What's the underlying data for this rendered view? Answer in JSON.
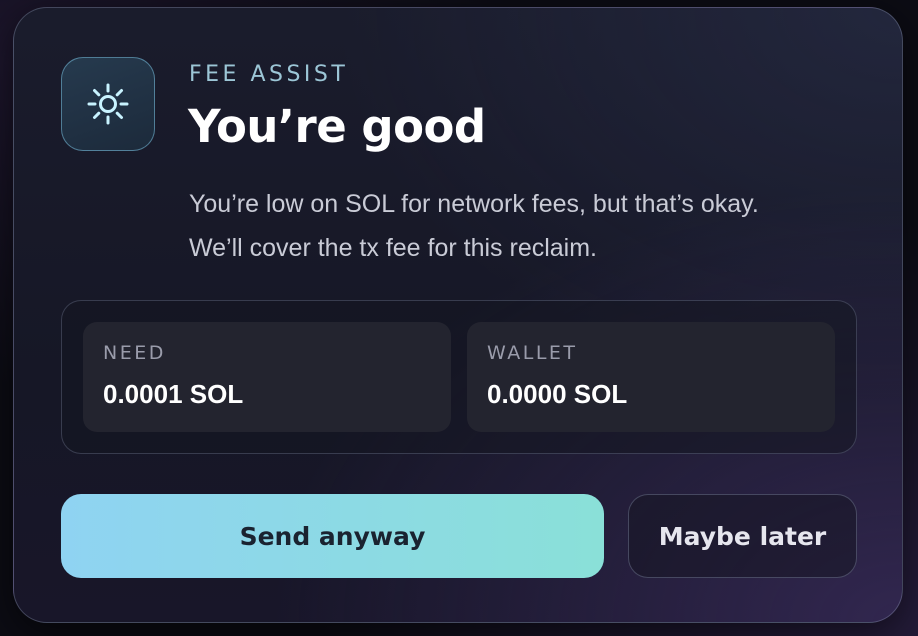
{
  "card": {
    "icon": "sun-icon",
    "eyebrow": "FEE ASSIST",
    "title": "You’re good",
    "body_line1": "You’re low on SOL for network fees, but that’s okay.",
    "body_line2": "We’ll cover the tx fee for this reclaim."
  },
  "stats": {
    "need": {
      "label": "NEED",
      "value": "0.0001 SOL"
    },
    "wallet": {
      "label": "WALLET",
      "value": "0.0000 SOL"
    }
  },
  "actions": {
    "primary_label": "Send anyway",
    "secondary_label": "Maybe later"
  },
  "colors": {
    "accent_start": "#8fd3f2",
    "accent_end": "#8ae0d8",
    "eyebrow": "#9cc6d6"
  }
}
